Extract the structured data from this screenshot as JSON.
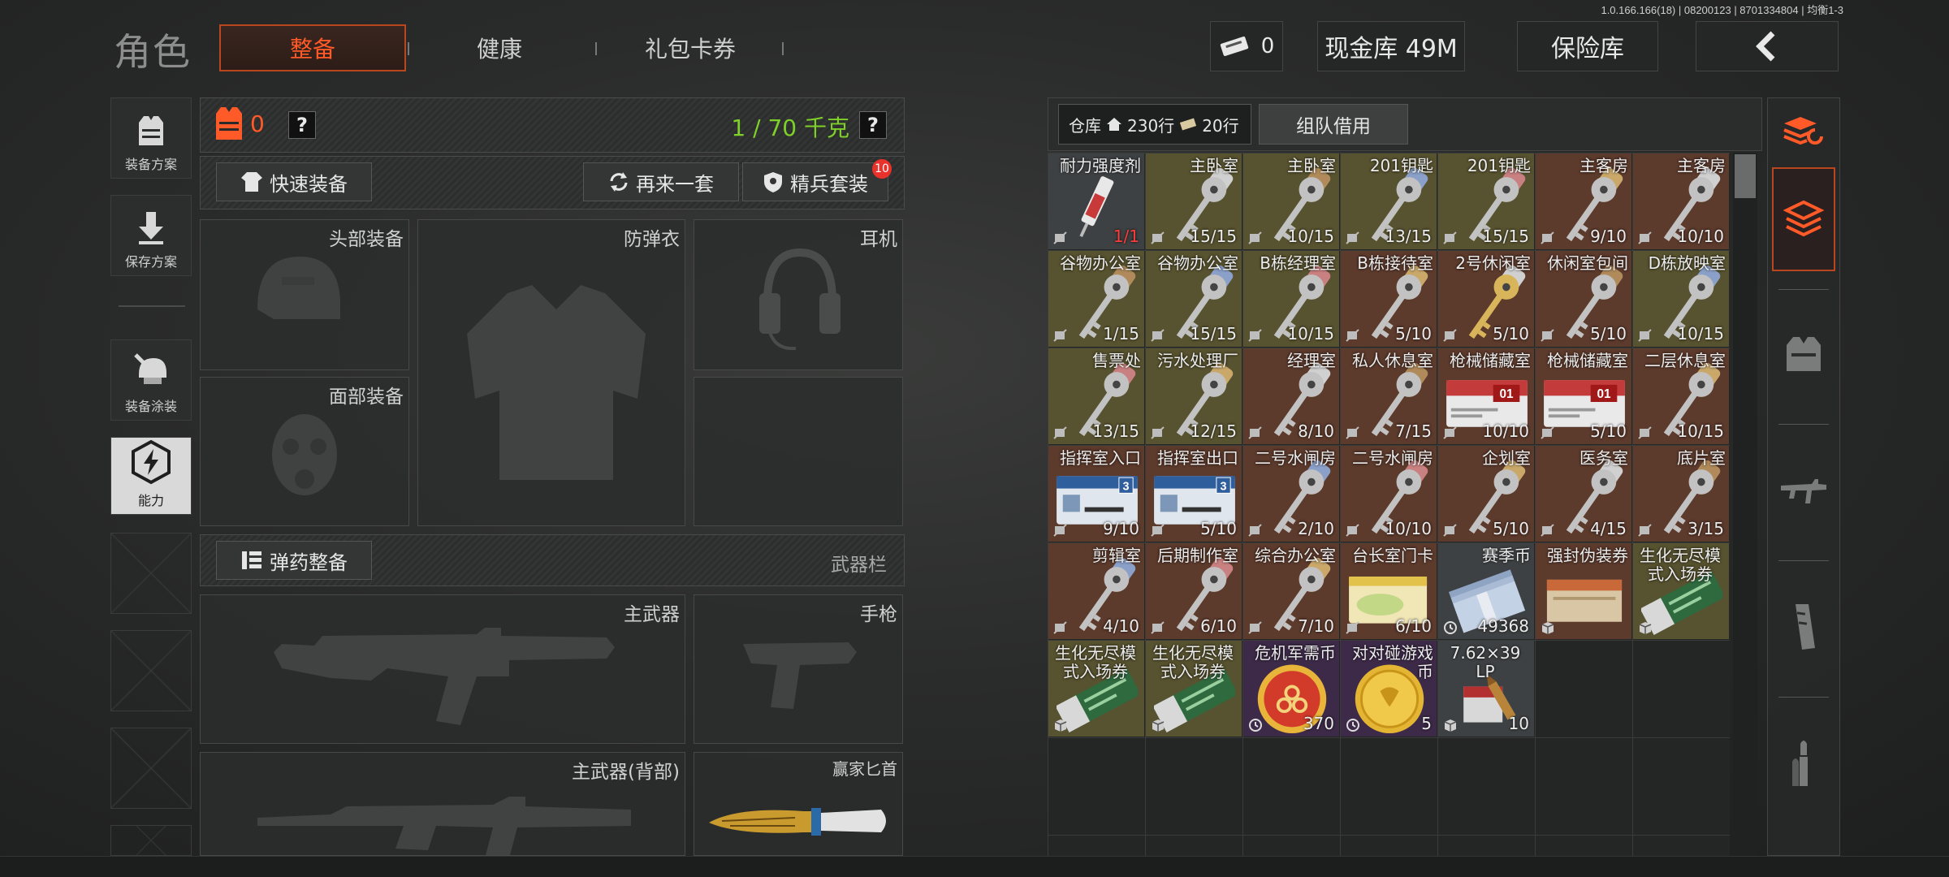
{
  "version": "1.0.166.166(18) | 08200123 | 8701334804 | 均衡1-3",
  "header": {
    "role_title": "角色",
    "tabs": [
      {
        "label": "整备",
        "active": true
      },
      {
        "label": "健康",
        "active": false
      },
      {
        "label": "礼包卡券",
        "active": false
      }
    ],
    "ticket_count": "0",
    "cash_label": "现金库 49M",
    "safe_label": "保险库"
  },
  "sidebar": {
    "items": [
      {
        "label": "装备方案",
        "icon": "vest-grid-icon"
      },
      {
        "label": "保存方案",
        "icon": "save-arrow-icon"
      },
      {
        "label": "装备涂装",
        "icon": "helmet-paint-icon"
      },
      {
        "label": "能力",
        "icon": "lightning-hex-icon",
        "active": true
      }
    ]
  },
  "gear": {
    "armor_count": "0",
    "help_mark": "?",
    "weight": "1 / 70 千克",
    "quick_equip": "快速装备",
    "again_set": "再来一套",
    "elite_set": "精兵套装",
    "elite_badge": "10",
    "slots": {
      "head": "头部装备",
      "armor": "防弹衣",
      "earphone": "耳机",
      "face": "面部装备"
    },
    "ammo_btn": "弹药整备",
    "weapon_bar": "武器栏",
    "weapons": {
      "primary": "主武器",
      "pistol": "手枪",
      "primary_back": "主武器(背部)",
      "melee": "赢家匕首"
    }
  },
  "warehouse": {
    "label": "仓库",
    "rows_a": "230行",
    "rows_b": "20行",
    "team_borrow": "组队借用",
    "items": [
      {
        "name": "耐力强度剂",
        "count": "1/1",
        "bg": "gray",
        "art": "syringe",
        "count_color": "#ff3b3b"
      },
      {
        "name": "主卧室",
        "count": "15/15",
        "bg": "yellow",
        "art": "key"
      },
      {
        "name": "主卧室",
        "count": "10/15",
        "bg": "yellow",
        "art": "key"
      },
      {
        "name": "201钥匙",
        "count": "13/15",
        "bg": "yellow",
        "art": "key"
      },
      {
        "name": "201钥匙",
        "count": "15/15",
        "bg": "yellow",
        "art": "key"
      },
      {
        "name": "主客房",
        "count": "9/10",
        "bg": "brown",
        "art": "key"
      },
      {
        "name": "主客房",
        "count": "10/10",
        "bg": "brown",
        "art": "key"
      },
      {
        "name": "谷物办公室",
        "count": "1/15",
        "bg": "yellow",
        "art": "key"
      },
      {
        "name": "谷物办公室",
        "count": "15/15",
        "bg": "yellow",
        "art": "key"
      },
      {
        "name": "B栋经理室",
        "count": "10/15",
        "bg": "yellow",
        "art": "key"
      },
      {
        "name": "B栋接待室",
        "count": "5/10",
        "bg": "brown",
        "art": "key"
      },
      {
        "name": "2号休闲室",
        "count": "5/10",
        "bg": "brown",
        "art": "key-gold"
      },
      {
        "name": "休闲室包间",
        "count": "5/10",
        "bg": "brown",
        "art": "key"
      },
      {
        "name": "D栋放映室",
        "count": "10/15",
        "bg": "yellow",
        "art": "key"
      },
      {
        "name": "售票处",
        "count": "13/15",
        "bg": "yellow",
        "art": "key"
      },
      {
        "name": "污水处理厂",
        "count": "12/15",
        "bg": "yellow",
        "art": "key"
      },
      {
        "name": "经理室",
        "count": "8/10",
        "bg": "brown",
        "art": "key"
      },
      {
        "name": "私人休息室",
        "count": "7/15",
        "bg": "brown",
        "art": "key"
      },
      {
        "name": "枪械储藏室",
        "count": "10/10",
        "bg": "brown",
        "art": "card-red",
        "card_text": "01"
      },
      {
        "name": "枪械储藏室",
        "count": "5/10",
        "bg": "brown",
        "art": "card-red",
        "card_text": "01"
      },
      {
        "name": "二层休息室",
        "count": "10/15",
        "bg": "brown",
        "art": "key"
      },
      {
        "name": "指挥室入口",
        "count": "9/10",
        "bg": "brown",
        "art": "card-blue",
        "card_text": "3"
      },
      {
        "name": "指挥室出口",
        "count": "5/10",
        "bg": "brown",
        "art": "card-blue",
        "card_text": "3"
      },
      {
        "name": "二号水闸房",
        "count": "2/10",
        "bg": "brown",
        "art": "key"
      },
      {
        "name": "二号水闸房",
        "count": "10/10",
        "bg": "brown",
        "art": "key"
      },
      {
        "name": "企划室",
        "count": "5/10",
        "bg": "brown",
        "art": "key"
      },
      {
        "name": "医务室",
        "count": "4/15",
        "bg": "brown",
        "art": "key"
      },
      {
        "name": "底片室",
        "count": "3/15",
        "bg": "brown",
        "art": "key"
      },
      {
        "name": "剪辑室",
        "count": "4/10",
        "bg": "brown",
        "art": "key"
      },
      {
        "name": "后期制作室",
        "count": "6/10",
        "bg": "brown",
        "art": "key"
      },
      {
        "name": "综合办公室",
        "count": "7/10",
        "bg": "brown",
        "art": "key"
      },
      {
        "name": "台长室门卡",
        "count": "6/10",
        "bg": "brown",
        "art": "card-yellow"
      },
      {
        "name": "赛季币",
        "count": "49368",
        "bg": "gray",
        "art": "cash"
      },
      {
        "name": "强封伪装券",
        "count": "",
        "bg": "brown",
        "art": "box"
      },
      {
        "name": "生化无尽模式入场券",
        "count": "",
        "bg": "yellow",
        "art": "ticket-green"
      },
      {
        "name": "生化无尽模式入场券",
        "count": "",
        "bg": "yellow",
        "art": "ticket-green"
      },
      {
        "name": "生化无尽模式入场券",
        "count": "",
        "bg": "yellow",
        "art": "ticket-green"
      },
      {
        "name": "危机军需币",
        "count": "370",
        "bg": "purple",
        "art": "coin-red"
      },
      {
        "name": "对对碰游戏币",
        "count": "5",
        "bg": "purple",
        "art": "coin-gold"
      },
      {
        "name": "7.62×39 LP",
        "count": "10",
        "bg": "gray",
        "art": "ammo"
      }
    ]
  },
  "right_bar": {
    "icons": [
      "stack-refresh-icon",
      "stack-layer-icon",
      "vest-icon",
      "rifle-icon",
      "magazine-icon",
      "bullet-icon"
    ]
  },
  "colors": {
    "accent": "#ff5a28",
    "weight_green": "#7fd12a",
    "armor_orange": "#ff5a28",
    "badge_red": "#e8322b"
  }
}
